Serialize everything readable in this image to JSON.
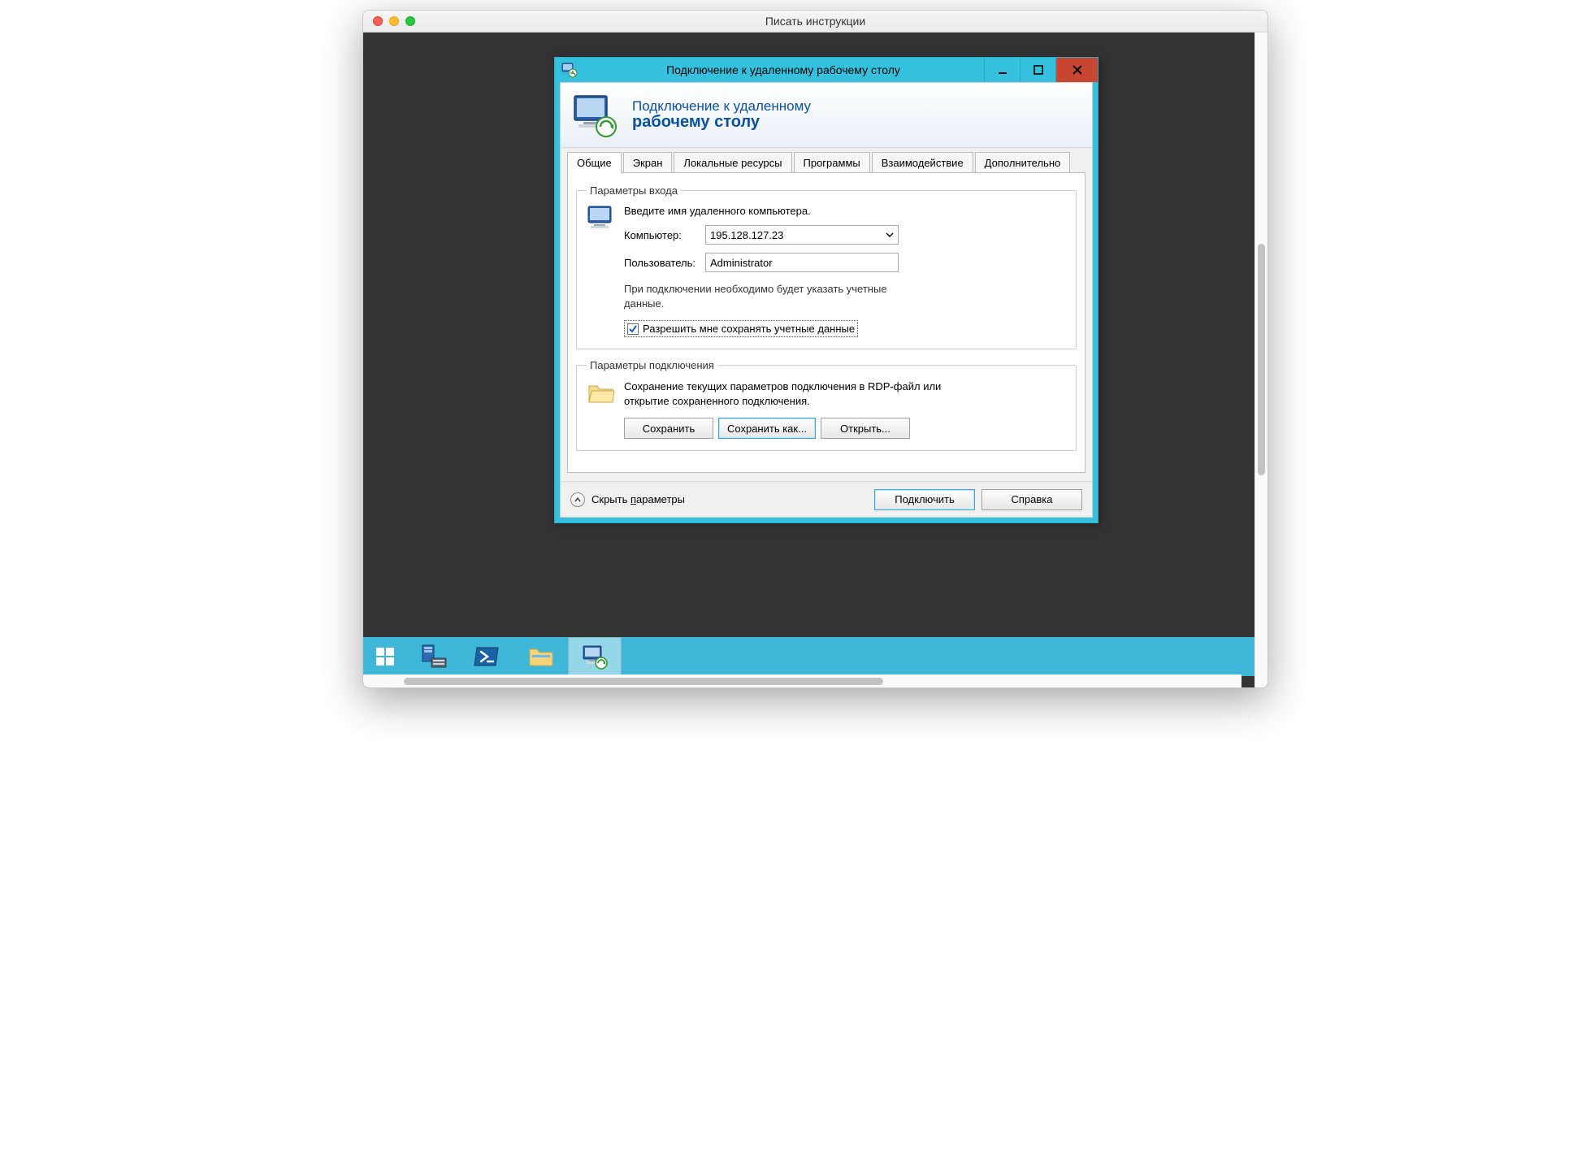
{
  "mac": {
    "title": "Писать инструкции"
  },
  "rdp_window": {
    "title": "Подключение к удаленному рабочему столу",
    "header_line1": "Подключение к удаленному",
    "header_line2": "рабочему столу"
  },
  "tabs": {
    "items": [
      {
        "label": "Общие",
        "active": true
      },
      {
        "label": "Экран"
      },
      {
        "label": "Локальные ресурсы"
      },
      {
        "label": "Программы"
      },
      {
        "label": "Взаимодействие"
      },
      {
        "label": "Дополнительно"
      }
    ]
  },
  "login_group": {
    "legend": "Параметры входа",
    "instruction": "Введите имя удаленного компьютера.",
    "computer_label": "Компьютер:",
    "computer_value": "195.128.127.23",
    "user_label": "Пользователь:",
    "user_value": "Administrator",
    "note": "При подключении необходимо будет указать учетные данные.",
    "save_creds_label": "Разрешить мне сохранять учетные данные",
    "save_creds_checked": true
  },
  "conn_group": {
    "legend": "Параметры подключения",
    "note": "Сохранение текущих параметров подключения в RDP-файл или открытие сохраненного подключения.",
    "save_label": "Сохранить",
    "save_as_label": "Сохранить как...",
    "open_label": "Открыть..."
  },
  "footer": {
    "hide_params_prefix": "Скрыть ",
    "hide_params_underlined": "п",
    "hide_params_suffix": "араметры",
    "connect_label": "Подключить",
    "help_label": "Справка"
  }
}
